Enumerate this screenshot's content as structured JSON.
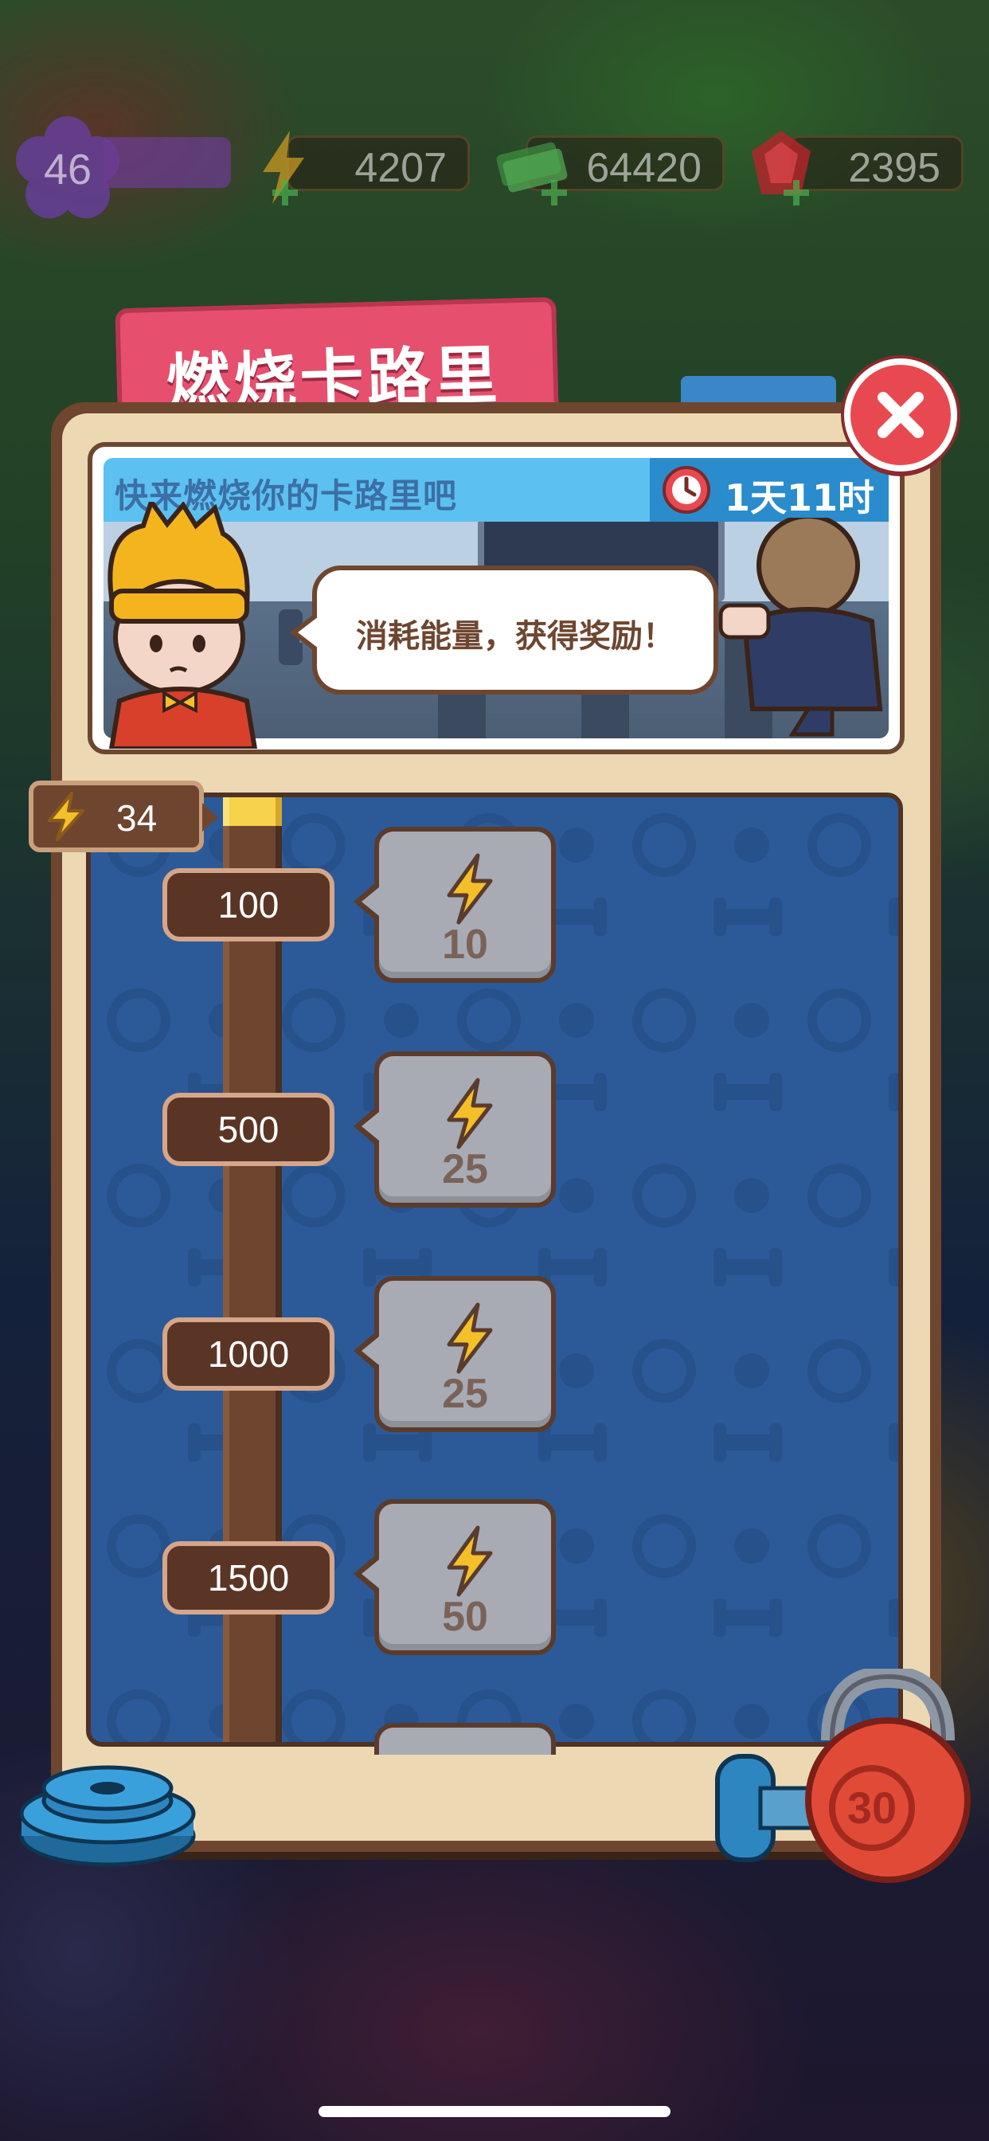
{
  "hud": {
    "level": "46",
    "energy": "4207",
    "cash": "64420",
    "gems": "2395",
    "colors": {
      "energy": "#f4c02a",
      "cash": "#4caf50",
      "gems": "#e03a3a",
      "level": "#7b4bb5"
    }
  },
  "panel": {
    "title": "燃烧卡路里",
    "close_icon": "close-icon",
    "banner": {
      "header": "快来燃烧你的卡路里吧",
      "timer": "1天11时",
      "speech": "消耗能量，获得奖励！"
    },
    "current_energy": "34",
    "progress_fraction": 0.03,
    "milestones": [
      {
        "threshold": "100",
        "reward": "10"
      },
      {
        "threshold": "500",
        "reward": "25"
      },
      {
        "threshold": "1000",
        "reward": "25"
      },
      {
        "threshold": "1500",
        "reward": "50"
      }
    ],
    "decor": {
      "kettlebell_label": "30"
    }
  },
  "colors": {
    "accent_pink": "#e6506e",
    "frame_brown": "#6e4630",
    "track_blue": "#2c5a98",
    "close_red": "#e84950"
  }
}
